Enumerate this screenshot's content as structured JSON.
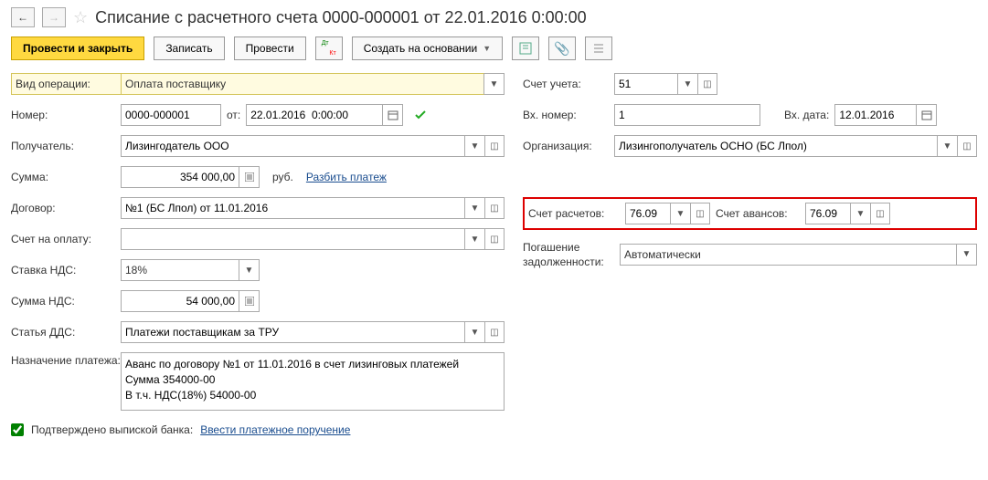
{
  "header": {
    "title": "Списание с расчетного счета 0000-000001 от 22.01.2016 0:00:00"
  },
  "toolbar": {
    "post_close": "Провести и закрыть",
    "save": "Записать",
    "post": "Провести",
    "create_based": "Создать на основании"
  },
  "left": {
    "operation_type_label": "Вид операции:",
    "operation_type_value": "Оплата поставщику",
    "number_label": "Номер:",
    "number_value": "0000-000001",
    "from_label": "от:",
    "date_value": "22.01.2016  0:00:00",
    "payee_label": "Получатель:",
    "payee_value": "Лизингодатель ООО",
    "sum_label": "Сумма:",
    "sum_value": "354 000,00",
    "currency": "руб.",
    "split_link": "Разбить платеж",
    "contract_label": "Договор:",
    "contract_value": "№1 (БС Лпол) от 11.01.2016",
    "invoice_label": "Счет на оплату:",
    "invoice_value": "",
    "vat_rate_label": "Ставка НДС:",
    "vat_rate_value": "18%",
    "vat_sum_label": "Сумма НДС:",
    "vat_sum_value": "54 000,00",
    "dds_label": "Статья ДДС:",
    "dds_value": "Платежи поставщикам за ТРУ",
    "purpose_label": "Назначение платежа:",
    "purpose_value": "Аванс по договору №1 от 11.01.2016 в счет лизинговых платежей\nСумма 354000-00\nВ т.ч. НДС(18%) 54000-00"
  },
  "right": {
    "account_label": "Счет учета:",
    "account_value": "51",
    "in_number_label": "Вх. номер:",
    "in_number_value": "1",
    "in_date_label": "Вх. дата:",
    "in_date_value": "12.01.2016",
    "org_label": "Организация:",
    "org_value": "Лизингополучатель ОСНО (БС Лпол)",
    "settle_acc_label": "Счет расчетов:",
    "settle_acc_value": "76.09",
    "advance_acc_label": "Счет авансов:",
    "advance_acc_value": "76.09",
    "debt_label1": "Погашение",
    "debt_label2": "задолженности:",
    "debt_value": "Автоматически"
  },
  "footer": {
    "confirmed_label": "Подтверждено выпиской банка:",
    "enter_order_link": "Ввести платежное поручение"
  }
}
